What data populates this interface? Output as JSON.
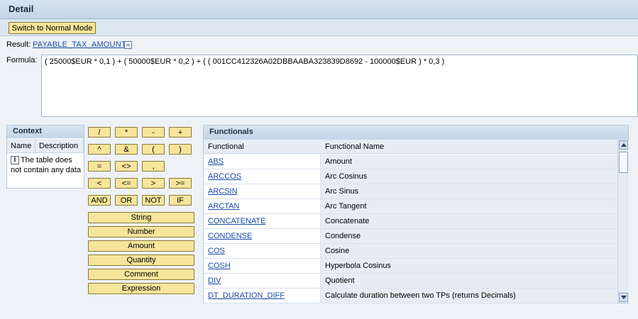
{
  "header": {
    "title": "Detail"
  },
  "toolbar": {
    "switch_label": "Switch to Normal Mode"
  },
  "result": {
    "label": "Result:",
    "value": "PAYABLE_TAX_AMOUNT",
    "icon": "edit-icon"
  },
  "formula": {
    "label": "Formula:",
    "value": "( 25000$EUR * 0,1 ) + ( 50000$EUR * 0,2 ) + ( ( 001CC412326A02DBBAABA323839D8692 - 100000$EUR ) * 0,3 )"
  },
  "context": {
    "title": "Context",
    "columns": [
      "Name",
      "Description"
    ],
    "empty_message": "The table does not contain any data",
    "icon": "info-icon"
  },
  "operators": {
    "row1": [
      "/",
      "*",
      "-",
      "+"
    ],
    "row2": [
      "^",
      "&",
      "(",
      ")"
    ],
    "row3": [
      "=",
      "<>",
      ","
    ],
    "row4": [
      "<",
      "<=",
      ">",
      ">="
    ],
    "row5": [
      "AND",
      "OR",
      "NOT",
      "IF"
    ]
  },
  "type_buttons": [
    "String",
    "Number",
    "Amount",
    "Quantity",
    "Comment",
    "Expression"
  ],
  "functionals": {
    "title": "Functionals",
    "columns": [
      "Functional",
      "Functional Name"
    ],
    "rows": [
      {
        "name": "ABS",
        "desc": "Amount"
      },
      {
        "name": "ARCCOS",
        "desc": "Arc Cosinus"
      },
      {
        "name": "ARCSIN",
        "desc": "Arc Sinus"
      },
      {
        "name": "ARCTAN",
        "desc": "Arc Tangent"
      },
      {
        "name": "CONCATENATE",
        "desc": "Concatenate"
      },
      {
        "name": "CONDENSE",
        "desc": "Condense"
      },
      {
        "name": "COS",
        "desc": "Cosine"
      },
      {
        "name": "COSH",
        "desc": "Hyperbola Cosinus"
      },
      {
        "name": "DIV",
        "desc": "Quotient"
      },
      {
        "name": "DT_DURATION_DIFF",
        "desc": "Calculate duration between two TPs (returns Decimals)"
      }
    ]
  },
  "colors": {
    "button_bg": "#f6e59a",
    "link": "#1a4aa6",
    "header_bg": "#c3d5e8"
  }
}
